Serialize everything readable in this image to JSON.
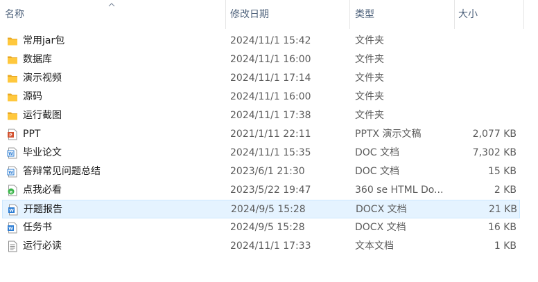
{
  "columns": {
    "name": "名称",
    "date": "修改日期",
    "type": "类型",
    "size": "大小"
  },
  "files": [
    {
      "name": "常用jar包",
      "date": "2024/11/1 15:42",
      "type": "文件夹",
      "size": "",
      "icon": "folder-icon"
    },
    {
      "name": "数据库",
      "date": "2024/11/1 16:00",
      "type": "文件夹",
      "size": "",
      "icon": "folder-icon"
    },
    {
      "name": "演示视频",
      "date": "2024/11/1 17:14",
      "type": "文件夹",
      "size": "",
      "icon": "folder-icon"
    },
    {
      "name": "源码",
      "date": "2024/11/1 16:00",
      "type": "文件夹",
      "size": "",
      "icon": "folder-icon"
    },
    {
      "name": "运行截图",
      "date": "2024/11/1 17:38",
      "type": "文件夹",
      "size": "",
      "icon": "folder-icon"
    },
    {
      "name": "PPT",
      "date": "2021/1/11 22:11",
      "type": "PPTX 演示文稿",
      "size": "2,077 KB",
      "icon": "pptx-file-icon"
    },
    {
      "name": "毕业论文",
      "date": "2024/11/1 15:35",
      "type": "DOC 文档",
      "size": "7,302 KB",
      "icon": "doc-file-icon"
    },
    {
      "name": "答辩常见问题总结",
      "date": "2023/6/1 21:30",
      "type": "DOC 文档",
      "size": "15 KB",
      "icon": "doc-file-icon"
    },
    {
      "name": "点我必看",
      "date": "2023/5/22 19:47",
      "type": "360 se HTML Do...",
      "size": "2 KB",
      "icon": "html-file-icon"
    },
    {
      "name": "开题报告",
      "date": "2024/9/5 15:28",
      "type": "DOCX 文档",
      "size": "21 KB",
      "icon": "docx-file-icon",
      "selected": true
    },
    {
      "name": "任务书",
      "date": "2024/9/5 15:28",
      "type": "DOCX 文档",
      "size": "16 KB",
      "icon": "docx-file-icon"
    },
    {
      "name": "运行必读",
      "date": "2024/11/1 17:33",
      "type": "文本文档",
      "size": "1 KB",
      "icon": "txt-file-icon"
    }
  ]
}
